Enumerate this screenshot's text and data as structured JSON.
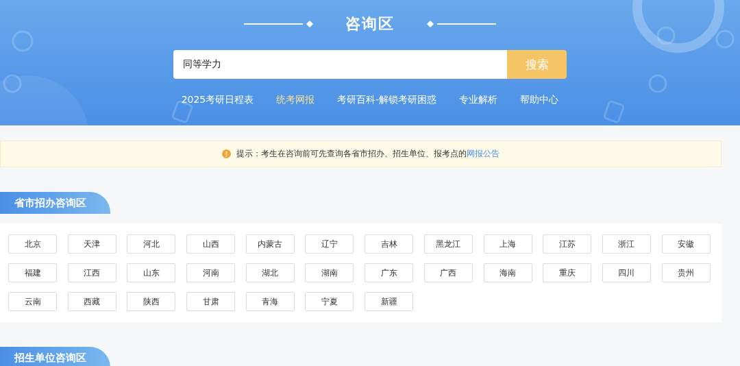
{
  "header": {
    "title": "咨询区",
    "search": {
      "value": "同等学力",
      "button": "搜索"
    },
    "nav": [
      {
        "label": "2025考研日程表",
        "selected": false
      },
      {
        "label": "统考网报",
        "selected": true
      },
      {
        "label": "考研百科-解锁考研困惑",
        "selected": false
      },
      {
        "label": "专业解析",
        "selected": false
      },
      {
        "label": "帮助中心",
        "selected": false
      }
    ]
  },
  "notice": {
    "text": "提示：考生在咨询前可先查询各省市招办、招生单位、报考点的",
    "link": "网报公告"
  },
  "sections": [
    {
      "title": "省市招办咨询区",
      "items": [
        "北京",
        "天津",
        "河北",
        "山西",
        "内蒙古",
        "辽宁",
        "吉林",
        "黑龙江",
        "上海",
        "江苏",
        "浙江",
        "安徽",
        "福建",
        "江西",
        "山东",
        "河南",
        "湖北",
        "湖南",
        "广东",
        "广西",
        "海南",
        "重庆",
        "四川",
        "贵州",
        "云南",
        "西藏",
        "陕西",
        "甘肃",
        "青海",
        "宁夏",
        "新疆"
      ]
    },
    {
      "title": "招生单位咨询区"
    }
  ]
}
